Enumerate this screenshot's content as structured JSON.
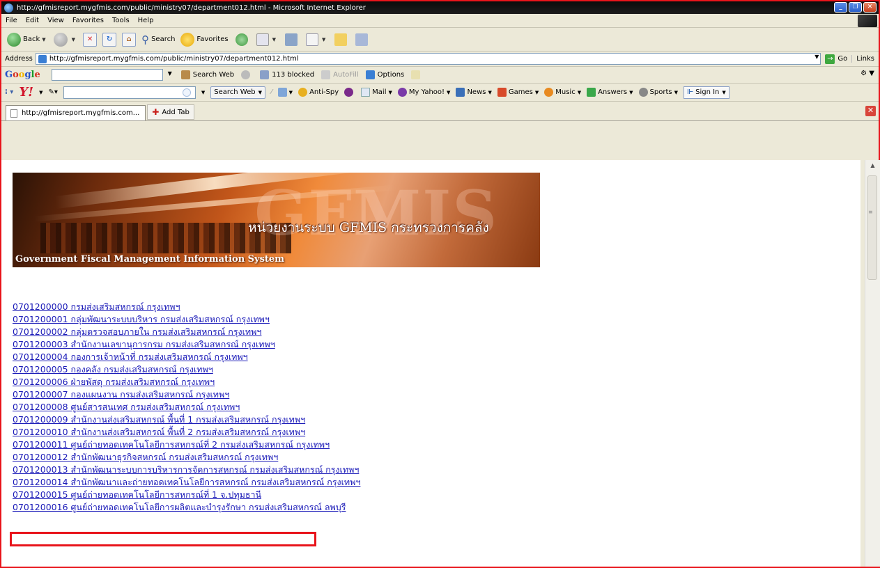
{
  "window": {
    "title": "http://gfmisreport.mygfmis.com/public/ministry07/department012.html - Microsoft Internet Explorer"
  },
  "menu": [
    "File",
    "Edit",
    "View",
    "Favorites",
    "Tools",
    "Help"
  ],
  "toolbar": {
    "back_label": "Back",
    "search_label": "Search",
    "favorites_label": "Favorites"
  },
  "address": {
    "label": "Address",
    "url": "http://gfmisreport.mygfmis.com/public/ministry07/department012.html",
    "go_label": "Go",
    "links_label": "Links"
  },
  "google": {
    "logo": "Google",
    "search_web": "Search Web",
    "blocked": "113 blocked",
    "autofill": "AutoFill",
    "options": "Options"
  },
  "yahoo": {
    "logo": "Y!",
    "search_web": "Search Web",
    "anti_spy": "Anti-Spy",
    "mail": "Mail",
    "my_yahoo": "My Yahoo!",
    "news": "News",
    "games": "Games",
    "music": "Music",
    "answers": "Answers",
    "sports": "Sports",
    "sign_in": "Sign In"
  },
  "tabs": {
    "current": "http://gfmisreport.mygfmis.com...",
    "add_tab": "Add Tab"
  },
  "banner": {
    "watermark": "GFMIS",
    "thai_title": "หน่วยงานระบบ GFMIS กระทรวงการคลัง",
    "english_title": "Government Fiscal Management Information System"
  },
  "links": [
    "0701200000 กรมส่งเสริมสหกรณ์ กรุงเทพฯ",
    "0701200001 กลุ่มพัฒนาระบบบริหาร กรมส่งเสริมสหกรณ์ กรุงเทพฯ",
    "0701200002 กลุ่มตรวจสอบภายใน กรมส่งเสริมสหกรณ์ กรุงเทพฯ",
    "0701200003 สำนักงานเลขานุการกรม กรมส่งเสริมสหกรณ์ กรุงเทพฯ",
    "0701200004 กองการเจ้าหน้าที่ กรมส่งเสริมสหกรณ์ กรุงเทพฯ",
    "0701200005 กองคลัง กรมส่งเสริมสหกรณ์ กรุงเทพฯ",
    "0701200006 ฝ่ายพัสดุ กรมส่งเสริมสหกรณ์ กรุงเทพฯ",
    "0701200007 กองแผนงาน กรมส่งเสริมสหกรณ์ กรุงเทพฯ",
    "0701200008 ศูนย์สารสนเทศ กรมส่งเสริมสหกรณ์ กรุงเทพฯ",
    "0701200009 สำนักงานส่งเสริมสหกรณ์ พื้นที่ 1 กรมส่งเสริมสหกรณ์ กรุงเทพฯ",
    "0701200010 สำนักงานส่งเสริมสหกรณ์ พื้นที่ 2 กรมส่งเสริมสหกรณ์ กรุงเทพฯ",
    "0701200011 ศูนย์ถ่ายทอดเทคโนโลยีการสหกรณ์ที่ 2 กรมส่งเสริมสหกรณ์ กรุงเทพฯ",
    "0701200012 สำนักพัฒนาธุรกิจสหกรณ์ กรมส่งเสริมสหกรณ์ กรุงเทพฯ",
    "0701200013 สำนักพัฒนาระบบการบริหารการจัดการสหกรณ์ กรมส่งเสริมสหกรณ์ กรุงเทพฯ",
    "0701200014 สำนักพัฒนาและถ่ายทอดเทคโนโลยีการสหกรณ์ กรมส่งเสริมสหกรณ์ กรุงเทพฯ",
    "0701200015 ศูนย์ถ่ายทอดเทคโนโลยีการสหกรณ์ที่ 1 จ.ปทุมธานี",
    "0701200016 ศูนย์ถ่ายทอดเทคโนโลยีการผลิตและบำรุงรักษา กรมส่งเสริมสหกรณ์ ลพบุรี"
  ],
  "colors": {
    "highlight_border": "#e8141b",
    "link": "#1a1ab8"
  }
}
